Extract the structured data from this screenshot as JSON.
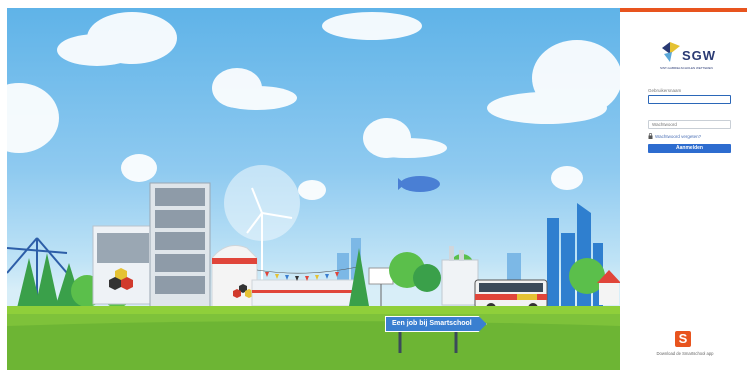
{
  "scene": {
    "sign_label": "Een job bij Smartschool"
  },
  "login": {
    "logo_text": "SGW",
    "logo_subtitle": "SINT-GABRIELSCHOLEN WETTEREN",
    "username_label": "Gebruikersnaam",
    "username_value": "",
    "password_placeholder": "Wachtwoord",
    "forgot_label": "Wachtwoord vergeten?",
    "submit_label": "Aanmelden"
  },
  "footer": {
    "app_icon_letter": "S",
    "app_text": "Download de Smartschool app"
  },
  "colors": {
    "accent": "#e8541e",
    "primary_button": "#2d6ccf",
    "brand_text": "#2a3a73"
  }
}
